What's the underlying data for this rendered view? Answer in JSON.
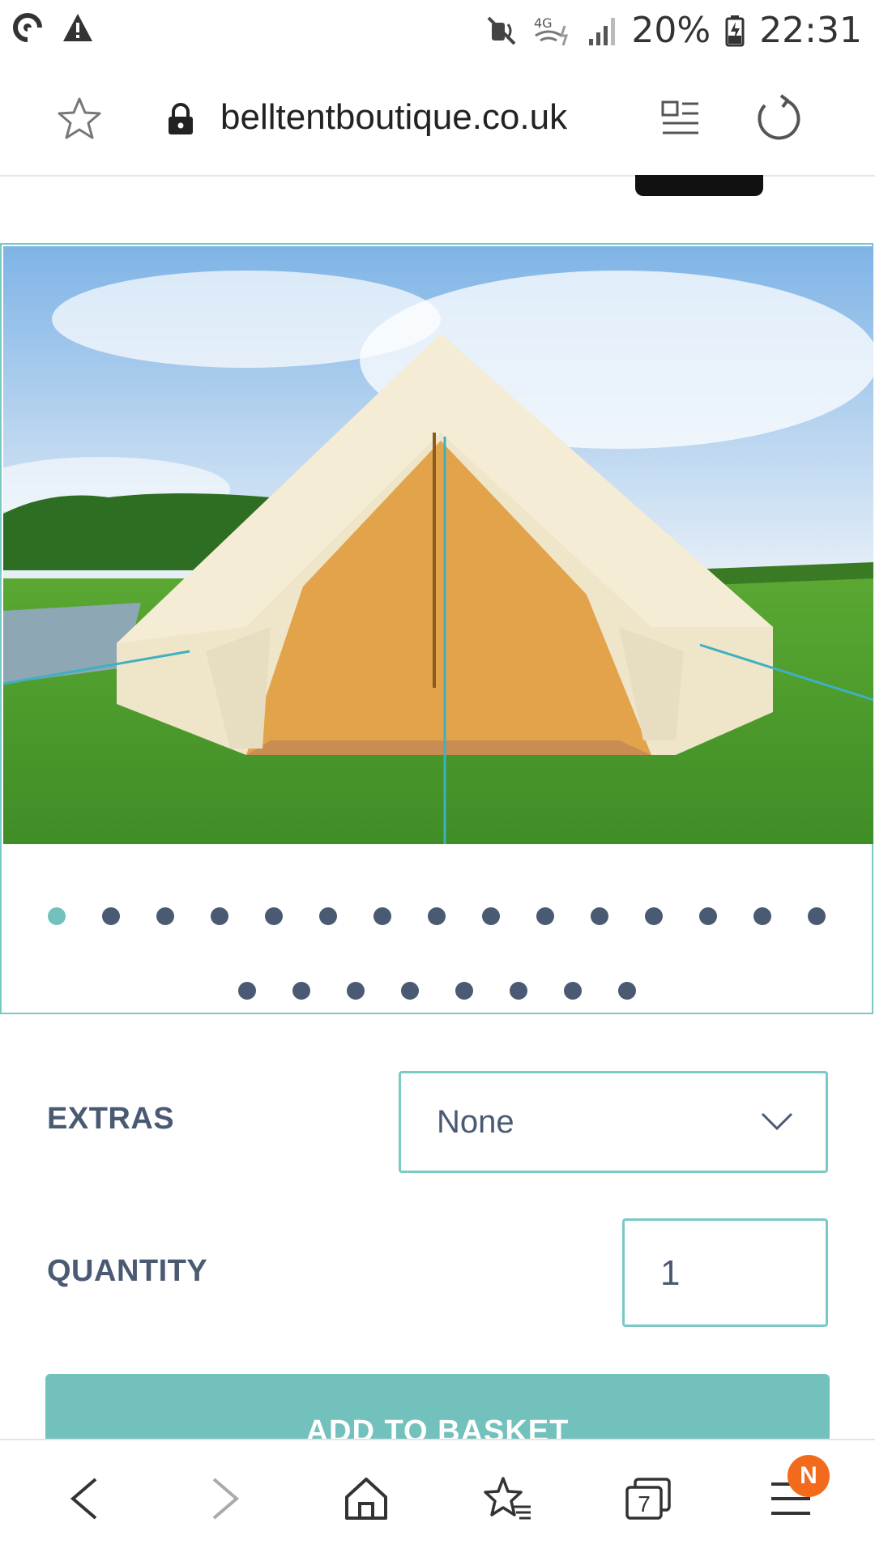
{
  "status_bar": {
    "battery": "20%",
    "time": "22:31",
    "network": "4G",
    "icons": [
      "sync-icon",
      "warning-icon",
      "mute-icon",
      "wifi-4g-icon",
      "signal-icon",
      "battery-charging-icon"
    ]
  },
  "browser": {
    "url": "belltentboutique.co.uk",
    "icons": [
      "favorite-star-icon",
      "lock-icon",
      "reader-mode-icon",
      "reload-icon"
    ]
  },
  "carousel": {
    "image_description_icon": "tent-photo",
    "dot_rows": [
      15,
      8
    ],
    "active_dot_index": 0
  },
  "form": {
    "extras_label": "EXTRAS",
    "extras_value": "None",
    "quantity_label": "QUANTITY",
    "quantity_value": "1",
    "add_button_label": "ADD TO BASKET"
  },
  "bottom_nav": {
    "tabs_count": "7",
    "menu_badge": "N",
    "icons": [
      "back-icon",
      "forward-icon",
      "home-icon",
      "bookmarks-icon",
      "tabs-icon",
      "menu-icon"
    ]
  },
  "colors": {
    "accent": "#72c1bc",
    "text": "#4a5a73",
    "badge": "#f26b1d"
  }
}
